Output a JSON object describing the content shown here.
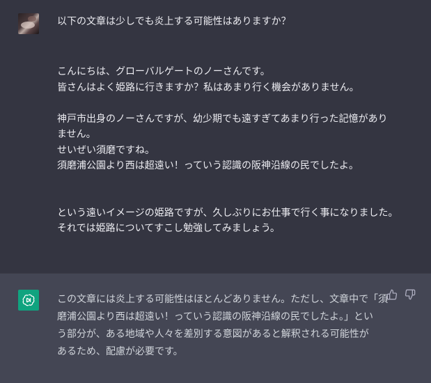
{
  "user_message": {
    "question": "以下の文章は少しでも炎上する可能性はありますか？",
    "lines": [
      "こんにちは、グローバルゲートのノーさんです。",
      "皆さんはよく姫路に行きますか？私はあまり行く機会がありません。",
      "",
      "神戸市出身のノーさんですが、幼少期でも遠すぎてあまり行った記憶があり",
      "ません。",
      "せいぜい須磨ですね。",
      "須磨浦公園より西は超遠い！っていう認識の阪神沿線の民でしたよ。",
      "",
      "",
      "という遠いイメージの姫路ですが、久しぶりにお仕事で行く事になりました。",
      "それでは姫路についてすこし勉強してみましょう。"
    ]
  },
  "assistant_message": {
    "lines": [
      "この文章には炎上する可能性はほとんどありません。ただし、文章中で「須",
      "磨浦公園より西は超遠い！っていう認識の阪神沿線の民でしたよ。」とい",
      "う部分が、ある地域や人々を差別する意図があると解釈される可能性が",
      "あるため、配慮が必要です。"
    ]
  },
  "icons": {
    "bot_avatar": "openai-logo-icon",
    "thumbs_up": "thumbs-up-icon",
    "thumbs_down": "thumbs-down-icon"
  },
  "colors": {
    "user_bg": "#343541",
    "assistant_bg": "#444654",
    "bot_avatar_bg": "#10a37f"
  }
}
